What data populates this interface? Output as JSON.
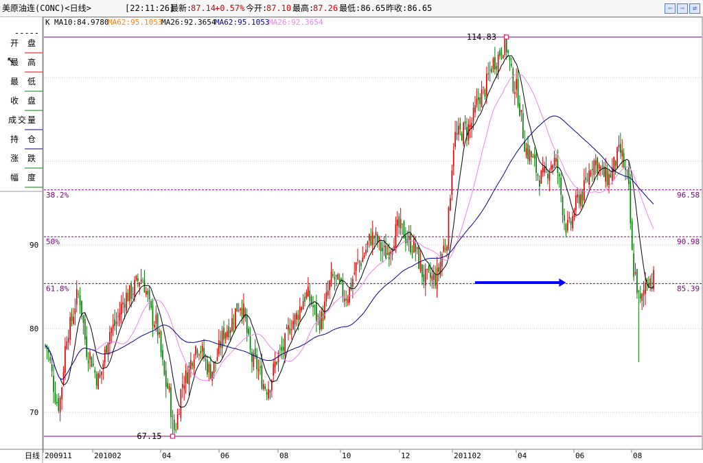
{
  "header": {
    "name": "美原油连(CONC)<日线>",
    "time": "[22:11:26]",
    "latest_label": "最新:",
    "latest_value": "87.14",
    "change": "+0.57%",
    "open_label": "今开:",
    "open_value": "87.10",
    "high_label": "最高:",
    "high_value": "87.26",
    "low_text": "最低:86.65",
    "prev_close_text": "昨收:86.65"
  },
  "legend": {
    "k_label": "K",
    "items": [
      {
        "text": "MA10:84.9780",
        "color": "#000000"
      },
      {
        "text": "MA62:95.1053",
        "color": "#ff8000"
      },
      {
        "text": "MA26:92.3654",
        "color": "#000000"
      },
      {
        "text": "MA62:95.1053",
        "color": "#00008b"
      },
      {
        "text": "MA26:92.3654",
        "color": "#ee82ee"
      }
    ]
  },
  "side_panel": {
    "dashes": "-----",
    "rows": [
      [
        "开",
        "盘"
      ],
      [
        "最",
        "高"
      ],
      [
        "最",
        "低"
      ],
      [
        "收",
        "盘"
      ],
      [
        "成",
        "交",
        "量"
      ],
      [
        "持",
        "仓"
      ],
      [
        "涨",
        "跌"
      ],
      [
        "幅",
        "度"
      ]
    ],
    "period_label": "日线"
  },
  "chart_data": {
    "type": "candlestick",
    "colors": {
      "up": "#e00000",
      "down": "#008000",
      "ma10": "#000000",
      "ma26": "#ee82ee",
      "ma62": "#00008b",
      "fib": "#800080",
      "arrow": "#0000ff"
    },
    "ylim": [
      67.15,
      114.83
    ],
    "yticks": [
      70,
      80,
      90
    ],
    "max_label": "114.83",
    "min_label": "67.15",
    "fib_levels": [
      {
        "label": "38.2%",
        "value": 96.58,
        "value_label": "96.58"
      },
      {
        "label": "50%",
        "value": 90.98,
        "value_label": "90.98"
      },
      {
        "label": "61.8%",
        "value": 85.39,
        "value_label": "85.39"
      }
    ],
    "x_labels": [
      "200911",
      "201002",
      "04",
      "06",
      "08",
      "10",
      "12",
      "201102",
      "04",
      "06",
      "08"
    ],
    "anchors": [
      [
        0,
        78
      ],
      [
        8,
        71
      ],
      [
        14,
        80
      ],
      [
        20,
        84
      ],
      [
        26,
        77
      ],
      [
        32,
        74
      ],
      [
        40,
        80
      ],
      [
        50,
        84
      ],
      [
        58,
        86
      ],
      [
        66,
        81
      ],
      [
        74,
        73
      ],
      [
        78,
        68
      ],
      [
        84,
        74
      ],
      [
        92,
        78
      ],
      [
        100,
        75
      ],
      [
        110,
        80
      ],
      [
        118,
        83
      ],
      [
        126,
        76
      ],
      [
        134,
        73
      ],
      [
        142,
        77
      ],
      [
        150,
        81
      ],
      [
        158,
        84
      ],
      [
        166,
        81
      ],
      [
        174,
        86
      ],
      [
        182,
        84
      ],
      [
        190,
        88
      ],
      [
        198,
        91
      ],
      [
        206,
        89
      ],
      [
        214,
        92
      ],
      [
        222,
        90
      ],
      [
        230,
        86
      ],
      [
        236,
        86
      ],
      [
        242,
        90
      ],
      [
        248,
        103
      ],
      [
        256,
        104
      ],
      [
        264,
        108
      ],
      [
        272,
        112
      ],
      [
        278,
        114
      ],
      [
        284,
        109
      ],
      [
        292,
        101
      ],
      [
        300,
        98
      ],
      [
        308,
        100
      ],
      [
        316,
        92
      ],
      [
        324,
        96
      ],
      [
        332,
        100
      ],
      [
        340,
        98
      ],
      [
        348,
        101
      ],
      [
        352,
        98
      ],
      [
        356,
        87
      ],
      [
        360,
        83
      ],
      [
        364,
        86
      ],
      [
        368,
        86
      ]
    ],
    "spikes": [
      {
        "day": 77,
        "low": 67.15
      },
      {
        "day": 279,
        "high": 114.83
      },
      {
        "day": 359,
        "low": 76
      }
    ],
    "arrow": {
      "from_day": 260,
      "to_day": 315,
      "value": 85.5
    }
  }
}
